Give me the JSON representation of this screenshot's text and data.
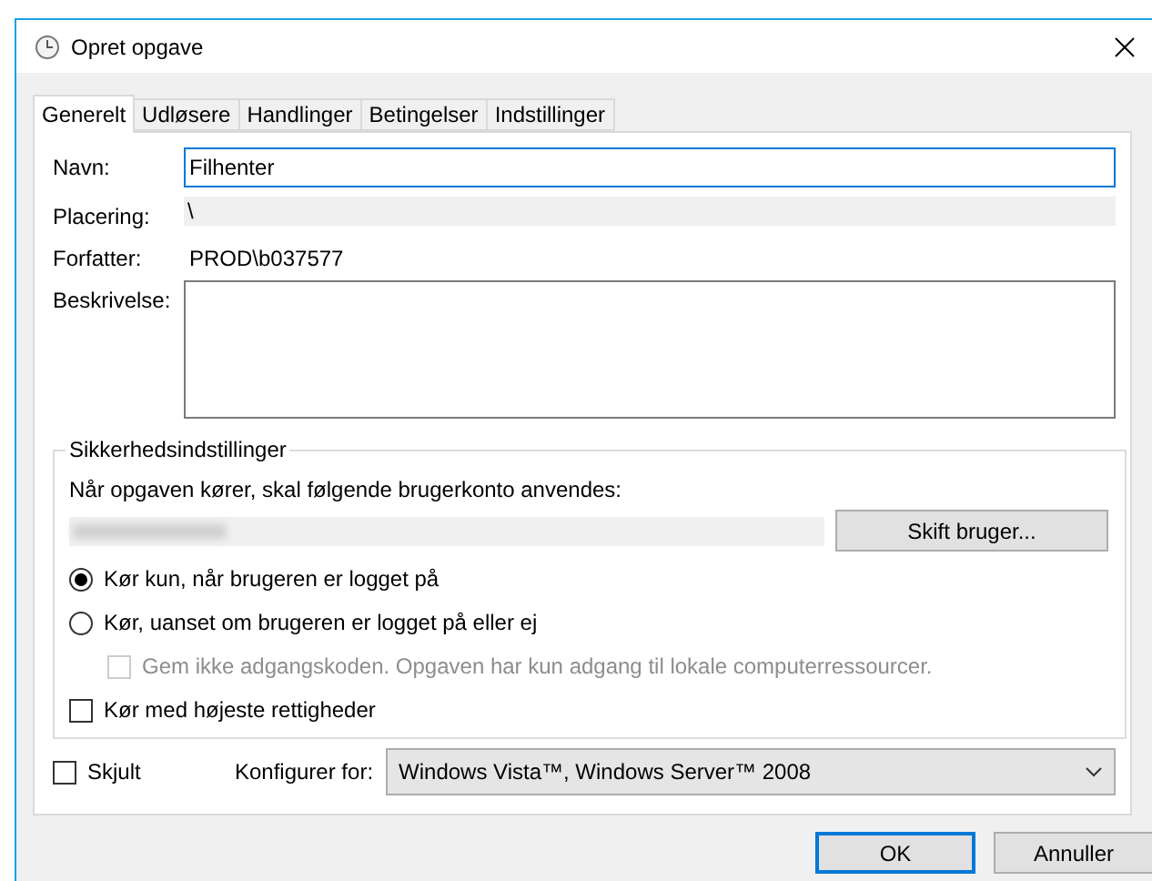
{
  "window": {
    "title": "Opret opgave"
  },
  "tabs": [
    {
      "label": "Generelt",
      "selected": true
    },
    {
      "label": "Udløsere",
      "selected": false
    },
    {
      "label": "Handlinger",
      "selected": false
    },
    {
      "label": "Betingelser",
      "selected": false
    },
    {
      "label": "Indstillinger",
      "selected": false
    }
  ],
  "fields": [
    {
      "kind": "input",
      "label": "Navn:",
      "value": "Filhenter",
      "focused": true
    },
    {
      "kind": "readonly",
      "label": "Placering:",
      "value": "\\"
    },
    {
      "kind": "text",
      "label": "Forfatter:",
      "value": "PROD\\b037577"
    },
    {
      "kind": "textarea",
      "label": "Beskrivelse:"
    }
  ],
  "security": {
    "title": "Sikkerhedsindstillinger",
    "prompt": "Når opgaven kører, skal følgende brugerkonto anvendes:",
    "account_button": "Skift bruger...",
    "options": [
      {
        "kind": "radio",
        "label": "Kør kun, når brugeren er logget på",
        "selected": true
      },
      {
        "kind": "radio",
        "label": "Kør, uanset om brugeren er logget på eller ej",
        "selected": false,
        "children": [
          {
            "kind": "checkbox",
            "label": "Gem ikke adgangskoden. Opgaven har kun adgang til lokale computerressourcer.",
            "checked": false,
            "disabled": true
          }
        ]
      },
      {
        "kind": "checkbox",
        "label": "Kør med højeste rettigheder",
        "checked": false,
        "disabled": false
      }
    ]
  },
  "hidden": {
    "label": "Skjult",
    "checked": false
  },
  "configure": {
    "label": "Konfigurer for:",
    "value": "Windows Vista™, Windows Server™ 2008"
  },
  "buttons": [
    {
      "label": "OK",
      "default": true
    },
    {
      "label": "Annuller",
      "default": false
    }
  ]
}
